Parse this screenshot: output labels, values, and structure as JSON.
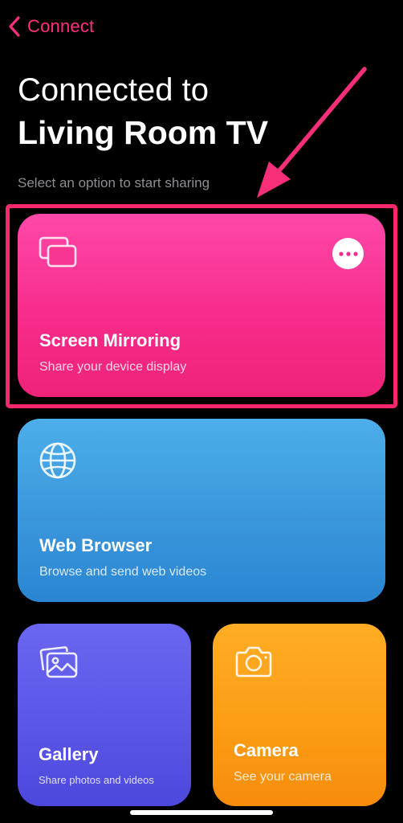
{
  "nav": {
    "back_label": "Connect"
  },
  "header": {
    "title_line1": "Connected to",
    "title_line2": "Living Room TV",
    "subtitle": "Select an option to start sharing"
  },
  "options": {
    "screen_mirroring": {
      "title": "Screen Mirroring",
      "subtitle": "Share your device display",
      "icon": "screen-mirroring-icon",
      "more_icon": "more-icon"
    },
    "web_browser": {
      "title": "Web Browser",
      "subtitle": "Browse and send web videos",
      "icon": "globe-icon"
    },
    "gallery": {
      "title": "Gallery",
      "subtitle": "Share photos and videos",
      "icon": "photos-icon"
    },
    "camera": {
      "title": "Camera",
      "subtitle": "See your camera",
      "icon": "camera-icon"
    }
  },
  "colors": {
    "accent": "#ff2e7e",
    "highlight": "#f7286d",
    "mirroring_card": "#f72c8c",
    "web_card": "#3b96db",
    "gallery_card": "#5a55e6",
    "camera_card": "#fb9c14"
  }
}
